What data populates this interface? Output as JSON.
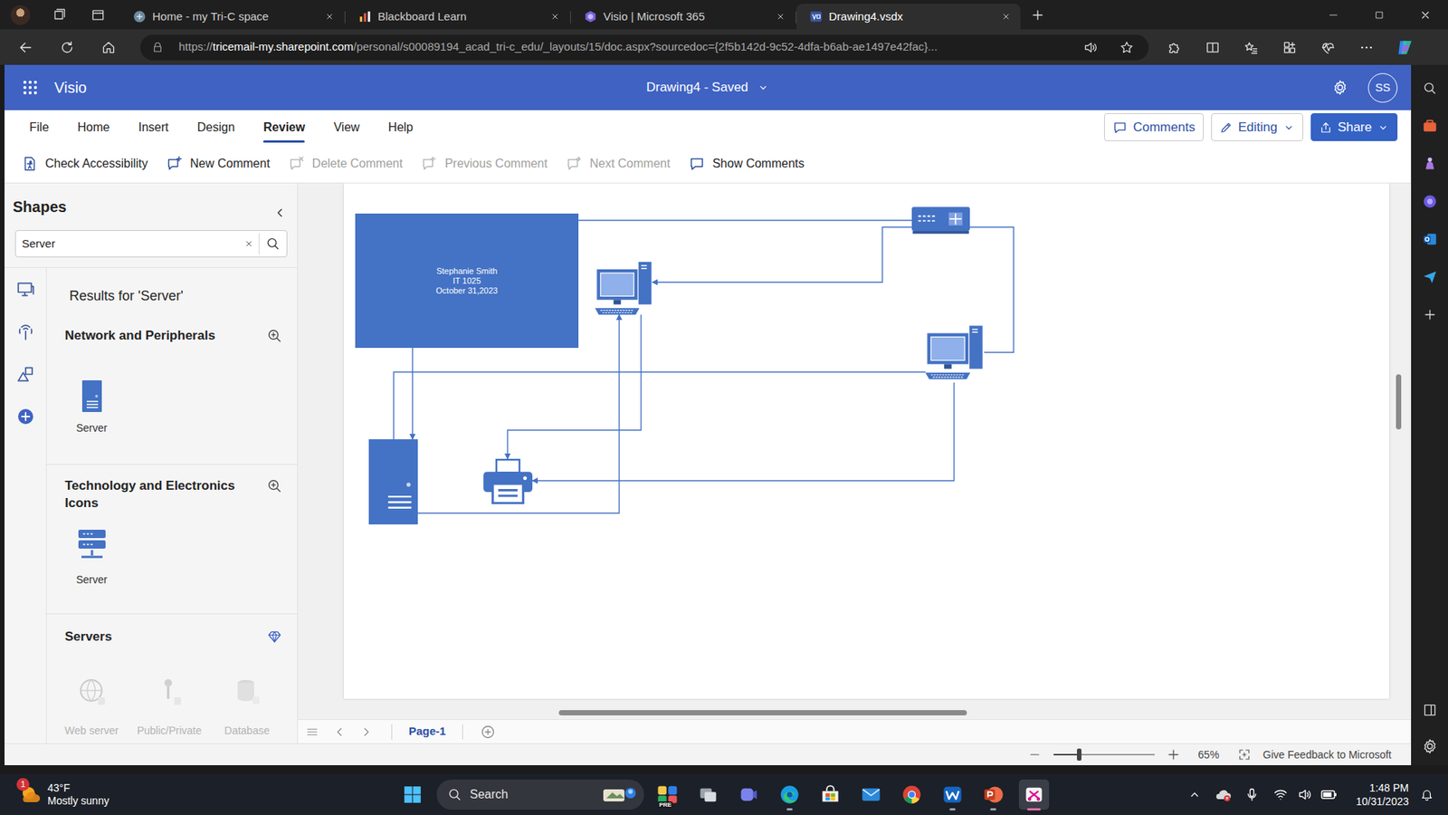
{
  "browser": {
    "tabs": [
      {
        "label": "Home - my Tri-C space",
        "selected": false
      },
      {
        "label": "Blackboard Learn",
        "selected": false
      },
      {
        "label": "Visio | Microsoft 365",
        "selected": false
      },
      {
        "label": "Drawing4.vsdx",
        "selected": true
      }
    ],
    "url": {
      "scheme": "https://",
      "host": "tricemail-my.sharepoint.com",
      "path": "/personal/s00089194_acad_tri-c_edu/_layouts/15/doc.aspx?sourcedoc={2f5b142d-9c52-4dfa-b6ab-ae1497e42fac}..."
    }
  },
  "app": {
    "name": "Visio",
    "document": "Drawing4 - Saved",
    "avatar": "SS"
  },
  "ribbon": {
    "tabs": [
      {
        "label": "File",
        "selected": false
      },
      {
        "label": "Home",
        "selected": false
      },
      {
        "label": "Insert",
        "selected": false
      },
      {
        "label": "Design",
        "selected": false
      },
      {
        "label": "Review",
        "selected": true
      },
      {
        "label": "View",
        "selected": false
      },
      {
        "label": "Help",
        "selected": false
      }
    ],
    "actions": [
      {
        "label": "Comments",
        "primary": false
      },
      {
        "label": "Editing",
        "primary": false
      },
      {
        "label": "Share",
        "primary": true
      }
    ],
    "commands": [
      {
        "label": "Check Accessibility",
        "disabled": false
      },
      {
        "label": "New Comment",
        "disabled": false
      },
      {
        "label": "Delete Comment",
        "disabled": true
      },
      {
        "label": "Previous Comment",
        "disabled": true
      },
      {
        "label": "Next Comment",
        "disabled": true
      },
      {
        "label": "Show Comments",
        "disabled": false
      }
    ]
  },
  "shapes": {
    "title": "Shapes",
    "search": "Server",
    "heading": "Results for 'Server'",
    "sections": [
      {
        "title": "Network and Peripherals",
        "premium": false,
        "items": [
          {
            "label": "Server",
            "disabled": false
          }
        ]
      },
      {
        "title": "Technology and Electronics Icons",
        "premium": false,
        "items": [
          {
            "label": "Server",
            "disabled": false
          }
        ]
      },
      {
        "title": "Servers",
        "premium": true,
        "items": [
          {
            "label": "Web server",
            "disabled": true
          },
          {
            "label": "Public/Private",
            "disabled": true
          },
          {
            "label": "Database",
            "disabled": true
          }
        ]
      }
    ]
  },
  "diagram": {
    "nodes": [
      {
        "kind": "textbox",
        "lines": [
          "Stephanie Smith",
          "IT 1025",
          "October 31,2023"
        ]
      },
      {
        "kind": "switch"
      },
      {
        "kind": "computer"
      },
      {
        "kind": "computer"
      },
      {
        "kind": "server"
      },
      {
        "kind": "printer"
      }
    ]
  },
  "pages": [
    {
      "label": "Page-1",
      "selected": true
    }
  ],
  "status_bar": {
    "zoom": "65%",
    "zoom_level": 0.26,
    "feedback": "Give Feedback to Microsoft"
  },
  "taskbar": {
    "weather": {
      "temperature": "43°F",
      "condition": "Mostly sunny",
      "badge": "1"
    },
    "search": "Search",
    "apps": [
      {
        "running": false,
        "active": false,
        "badge": "PRE"
      },
      {
        "running": false,
        "active": false
      },
      {
        "running": false,
        "active": false
      },
      {
        "running": true,
        "active": false
      },
      {
        "running": false,
        "active": false
      },
      {
        "running": false,
        "active": false
      },
      {
        "running": false,
        "active": false
      },
      {
        "running": true,
        "active": false
      },
      {
        "running": true,
        "active": false
      },
      {
        "running": true,
        "active": true
      }
    ],
    "time": "1:48 PM",
    "date": "10/31/2023"
  }
}
